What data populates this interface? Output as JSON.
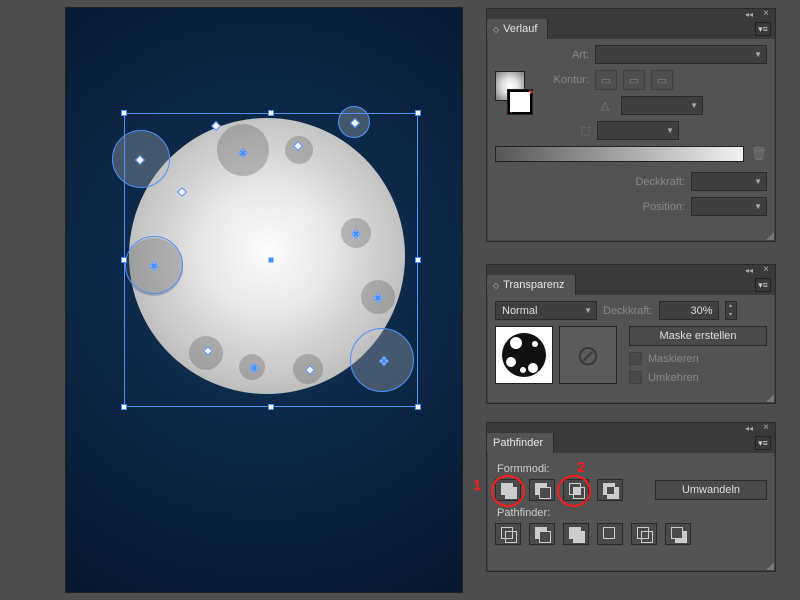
{
  "panels": {
    "gradient": {
      "title": "Verlauf",
      "type_label": "Art:",
      "stroke_label": "Kontur:",
      "opacity_label": "Deckkraft:",
      "position_label": "Position:"
    },
    "transparency": {
      "title": "Transparenz",
      "blend_mode": "Normal",
      "opacity_label": "Deckkraft:",
      "opacity_value": "30%",
      "make_mask_label": "Maske erstellen",
      "mask_label": "Maskieren",
      "invert_label": "Umkehren"
    },
    "pathfinder": {
      "title": "Pathfinder",
      "shapemodes_label": "Formmodi:",
      "expand_label": "Umwandeln",
      "pathfinder_label": "Pathfinder:"
    }
  },
  "annotations": {
    "mark1": "1",
    "mark2": "2"
  }
}
